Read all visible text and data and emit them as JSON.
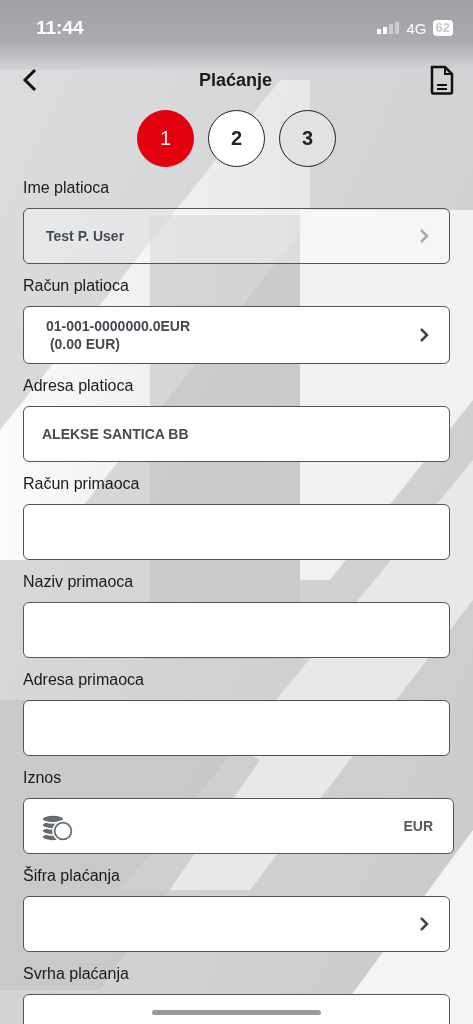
{
  "status_bar": {
    "time": "11:44",
    "network": "4G",
    "battery": "62"
  },
  "header": {
    "title": "Plaćanje"
  },
  "steps": [
    {
      "label": "1",
      "selected": true
    },
    {
      "label": "2",
      "selected": false
    },
    {
      "label": "3",
      "selected": false
    }
  ],
  "fields": [
    {
      "kind": "select",
      "label": "Ime platioca",
      "value": "Test P. User",
      "disabled": true
    },
    {
      "kind": "select",
      "label": "Račun platioca",
      "value": "01-001-0000000.0EUR\n (0.00 EUR)",
      "disabled": false
    },
    {
      "kind": "text",
      "label": "Adresa platioca",
      "value": "ALEKSE SANTICA BB",
      "disabled": false
    },
    {
      "kind": "text",
      "label": "Račun primaoca",
      "disabled": false
    },
    {
      "kind": "text",
      "label": "Naziv primaoca",
      "disabled": false
    },
    {
      "kind": "text",
      "label": "Adresa primaoca",
      "disabled": false
    },
    {
      "kind": "amount",
      "label": "Iznos",
      "currency": "EUR",
      "disabled": false
    },
    {
      "kind": "select",
      "label": "Šifra plaćanja",
      "disabled": false
    },
    {
      "kind": "text",
      "label": "Svrha plaćanja",
      "disabled": false
    }
  ]
}
